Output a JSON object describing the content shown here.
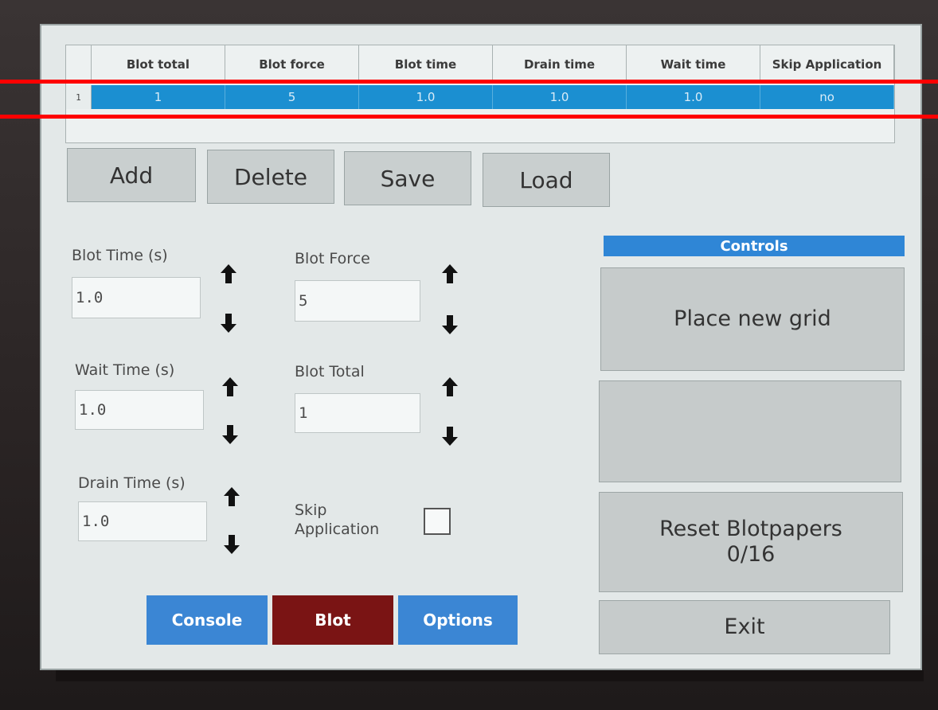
{
  "table": {
    "columns": [
      "Blot total",
      "Blot force",
      "Blot time",
      "Drain time",
      "Wait time",
      "Skip Application"
    ],
    "rows": [
      {
        "index": "1",
        "cells": [
          "1",
          "5",
          "1.0",
          "1.0",
          "1.0",
          "no"
        ]
      }
    ]
  },
  "toolbar": {
    "add": "Add",
    "delete": "Delete",
    "save": "Save",
    "load": "Load"
  },
  "form": {
    "blot_time_label": "Blot Time (s)",
    "blot_time_value": "1.0",
    "wait_time_label": "Wait Time (s)",
    "wait_time_value": "1.0",
    "drain_time_label": "Drain Time (s)",
    "drain_time_value": "1.0",
    "blot_force_label": "Blot Force",
    "blot_force_value": "5",
    "blot_total_label": "Blot Total",
    "blot_total_value": "1",
    "skip_application_label_1": "Skip",
    "skip_application_label_2": "Application",
    "skip_application_checked": false
  },
  "controls": {
    "header": "Controls",
    "place_new_grid": "Place new grid",
    "empty_button": "",
    "reset_blotpapers_line1": "Reset Blotpapers",
    "reset_blotpapers_line2": "0/16",
    "exit": "Exit"
  },
  "nav": {
    "console": "Console",
    "blot": "Blot",
    "options": "Options"
  },
  "colors": {
    "selected_row": "#1b8fd1",
    "controls_header": "#2f86d6",
    "nav_blue": "#3b86d4",
    "nav_active": "#7a1414",
    "overlay_red": "#ff0000"
  }
}
